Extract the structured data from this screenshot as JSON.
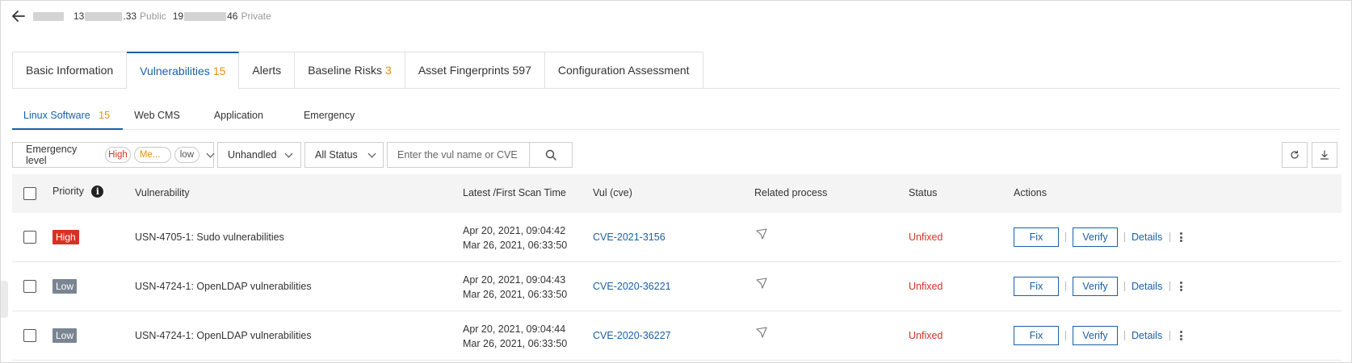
{
  "header": {
    "ip_public_prefix": "13",
    "ip_public_suffix": ".33",
    "public_label": "Public",
    "ip_private_prefix": "19",
    "ip_private_suffix": "46",
    "private_label": "Private"
  },
  "main_tabs": [
    {
      "label": "Basic Information",
      "count": ""
    },
    {
      "label": "Vulnerabilities",
      "count": "15"
    },
    {
      "label": "Alerts",
      "count": ""
    },
    {
      "label": "Baseline Risks",
      "count": "3"
    },
    {
      "label": "Asset Fingerprints 597",
      "count": ""
    },
    {
      "label": "Configuration Assessment",
      "count": ""
    }
  ],
  "sub_tabs": [
    {
      "label": "Linux Software",
      "count": "15"
    },
    {
      "label": "Web CMS",
      "count": ""
    },
    {
      "label": "Application",
      "count": ""
    },
    {
      "label": "Emergency",
      "count": ""
    }
  ],
  "filters": {
    "emergency_label": "Emergency level",
    "chips": [
      "High",
      "Me...",
      "low"
    ],
    "handled": "Unhandled",
    "status": "All Status",
    "search_placeholder": "Enter the vul name or CVE nu"
  },
  "table": {
    "headers": {
      "priority": "Priority",
      "vulnerability": "Vulnerability",
      "scan_time": "Latest /First Scan Time",
      "cve": "Vul (cve)",
      "process": "Related process",
      "status": "Status",
      "actions": "Actions"
    },
    "rows": [
      {
        "priority": "High",
        "name": "USN-4705-1: Sudo vulnerabilities",
        "latest": "Apr 20, 2021, 09:04:42",
        "first": "Mar 26, 2021, 06:33:50",
        "cve": "CVE-2021-3156",
        "status": "Unfixed"
      },
      {
        "priority": "Low",
        "name": "USN-4724-1: OpenLDAP vulnerabilities",
        "latest": "Apr 20, 2021, 09:04:43",
        "first": "Mar 26, 2021, 06:33:50",
        "cve": "CVE-2020-36221",
        "status": "Unfixed"
      },
      {
        "priority": "Low",
        "name": "USN-4724-1: OpenLDAP vulnerabilities",
        "latest": "Apr 20, 2021, 09:04:44",
        "first": "Mar 26, 2021, 06:33:50",
        "cve": "CVE-2020-36227",
        "status": "Unfixed"
      }
    ],
    "actions": {
      "fix": "Fix",
      "verify": "Verify",
      "details": "Details"
    }
  },
  "colors": {
    "accent": "#1a5fa8",
    "count": "#e6910a",
    "high": "#d93026",
    "low": "#7a8592",
    "unfixed": "#d93026"
  },
  "icons": [
    "back-arrow-icon",
    "info-icon",
    "search-icon",
    "refresh-icon",
    "download-icon",
    "process-arrow-icon",
    "more-icon",
    "chevron-down-icon"
  ]
}
